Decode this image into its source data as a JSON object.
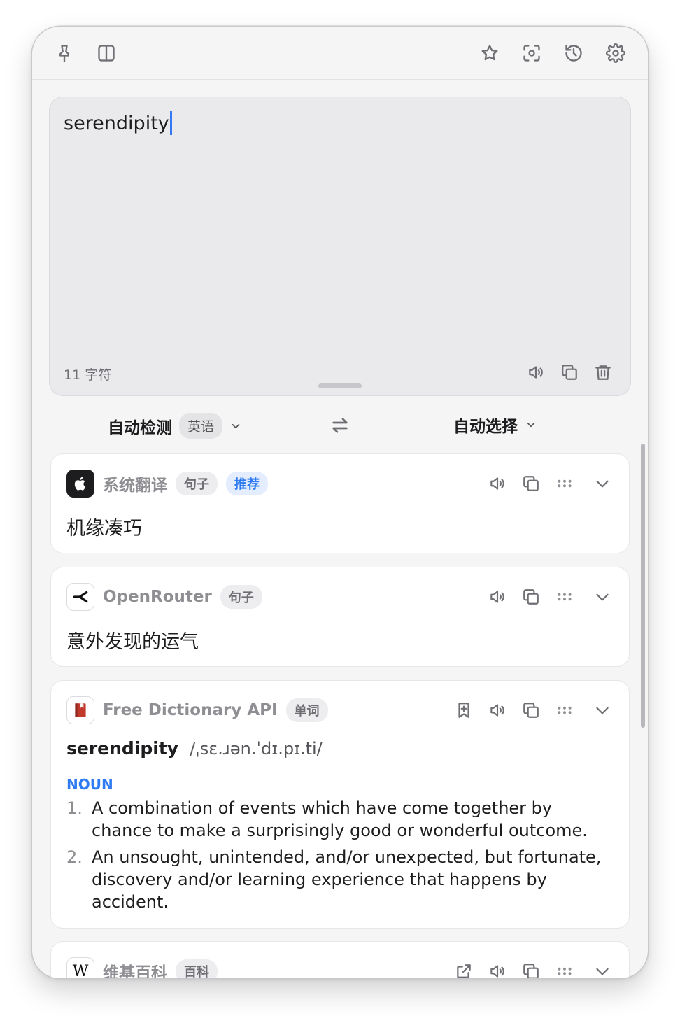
{
  "toolbar": {
    "left_icons": [
      "pin-icon",
      "sidebar-icon"
    ],
    "right_icons": [
      "star-icon",
      "screenshot-ocr-icon",
      "history-icon",
      "gear-icon"
    ]
  },
  "input": {
    "text": "serendipity",
    "char_count": "11 字符"
  },
  "languages": {
    "source": "自动检测",
    "detected": "英语",
    "target": "自动选择"
  },
  "cards": [
    {
      "service": "系统翻译",
      "chips": [
        "句子",
        "推荐"
      ],
      "result": "机缘凑巧"
    },
    {
      "service": "OpenRouter",
      "chips": [
        "句子"
      ],
      "result": "意外发现的运气"
    },
    {
      "service": "Free Dictionary API",
      "chips": [
        "单词"
      ],
      "word": "serendipity",
      "phonetic": "/ˌsɛ.ɹən.ˈdɪ.pɪ.ti/",
      "part_of_speech": "NOUN",
      "definitions": [
        {
          "num": "1.",
          "text": "A combination of events which have come together by chance to make a surprisingly good or wonderful outcome."
        },
        {
          "num": "2.",
          "text": "An unsought, unintended, and/or unexpected, but fortunate, discovery and/or learning experience that happens by accident."
        }
      ]
    },
    {
      "service": "维基百科",
      "chips": [
        "百科"
      ],
      "logo_letter": "W"
    }
  ],
  "colors": {
    "accent": "#2f7bf2",
    "caret": "#3478f6",
    "window_bg": "#f5f5f6",
    "card_bg": "#ffffff"
  }
}
